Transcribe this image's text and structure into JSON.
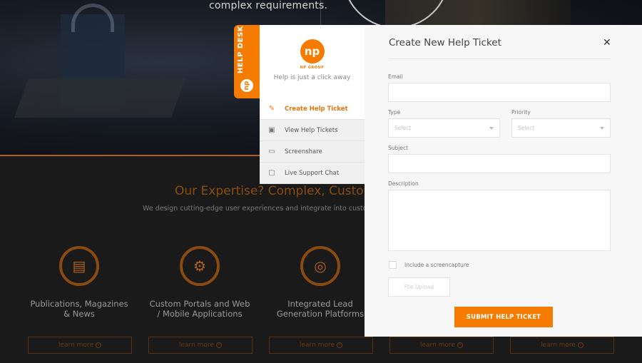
{
  "hero": {
    "tagline": "complex requirements."
  },
  "expertise": {
    "title": "Our Expertise? Complex, Custom D",
    "subtitle": "We design cutting-edge user experiences and integrate into customized",
    "services": [
      {
        "title": "Publications, Magazines & News",
        "icon": "newspaper-icon",
        "learn_more": "learn more"
      },
      {
        "title": "Custom Portals and Web / Mobile Applications",
        "icon": "monitor-gear-icon",
        "learn_more": "learn more"
      },
      {
        "title": "Integrated Lead Generation Platforms",
        "icon": "target-person-icon",
        "learn_more": "learn more"
      },
      {
        "title": "",
        "icon": "",
        "learn_more": "learn more"
      },
      {
        "title": "",
        "icon": "",
        "learn_more": "learn more"
      }
    ]
  },
  "helpdesk": {
    "tab_label": "HELP DESK",
    "logo_mark": "np",
    "logo_text": "NP GROUP",
    "tagline": "Help is just a click away",
    "menu": [
      {
        "label": "Create Help Ticket",
        "icon": "edit-ticket-icon",
        "active": true
      },
      {
        "label": "View Help Tickets",
        "icon": "inbox-icon",
        "active": false
      },
      {
        "label": "Screenshare",
        "icon": "monitor-icon",
        "active": false
      },
      {
        "label": "Live Support Chat",
        "icon": "chat-icon",
        "active": false
      }
    ]
  },
  "form": {
    "title": "Create New Help Ticket",
    "close": "✕",
    "email_label": "Email",
    "email_value": "",
    "type_label": "Type",
    "type_value": "Select",
    "priority_label": "Priority",
    "priority_value": "Select",
    "subject_label": "Subject",
    "subject_value": "",
    "description_label": "Description",
    "description_value": "",
    "screencapture_label": "Include a screencapture",
    "screencapture_checked": false,
    "upload_label": "File Upload",
    "submit_label": "SUBMIT HELP TICKET"
  },
  "colors": {
    "accent": "#f57c00",
    "dark_bg": "#1a1a1a"
  }
}
